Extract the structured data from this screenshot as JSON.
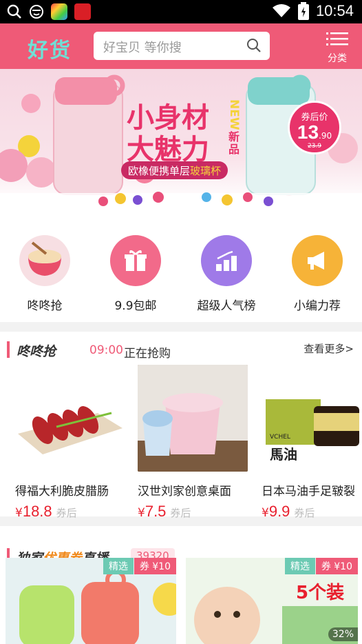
{
  "status_bar": {
    "time": "10:54"
  },
  "header": {
    "logo": "好货",
    "search_placeholder": "好宝贝 等你搜",
    "menu_label": "分类"
  },
  "banner": {
    "headline_1": "小身材",
    "headline_2": "大魅力",
    "new_tag": "NEW",
    "new_cn": "新品",
    "subtitle_plain": "欧橡便携单层",
    "subtitle_highlight": "玻璃杯",
    "coupon_label": "券后价",
    "price_main": "13",
    "price_decimal": ".90",
    "price_original": "23.9"
  },
  "quick_nav": [
    {
      "label": "咚咚抢",
      "color": "#f7d3d8"
    },
    {
      "label": "9.9包邮",
      "color": "#f26a8a"
    },
    {
      "label": "超级人气榜",
      "color": "#9f7ae8"
    },
    {
      "label": "小编力荐",
      "color": "#f6b338"
    }
  ],
  "flash_sale": {
    "title": "咚咚抢",
    "time": "09:00",
    "status": "正在抢购",
    "more": "查看更多>",
    "currency": "¥",
    "after_label": "券后",
    "products": [
      {
        "name": "得福大利脆皮腊肠",
        "price": "18.8"
      },
      {
        "name": "汉世刘家创意桌面",
        "price": "7.5"
      },
      {
        "name": "日本马油手足皲裂",
        "price": "9.9",
        "brand": "VCHEL",
        "label": "馬油"
      }
    ]
  },
  "coupon_live": {
    "title_plain_1": "独家",
    "title_highlight": "优惠券",
    "title_plain_2": "直播",
    "count": "39320",
    "cards": [
      {
        "tag": "精选",
        "coupon": "券 ¥10"
      },
      {
        "tag": "精选",
        "coupon": "券 ¥10",
        "overlay": "5个装",
        "percent": "32%"
      }
    ]
  }
}
